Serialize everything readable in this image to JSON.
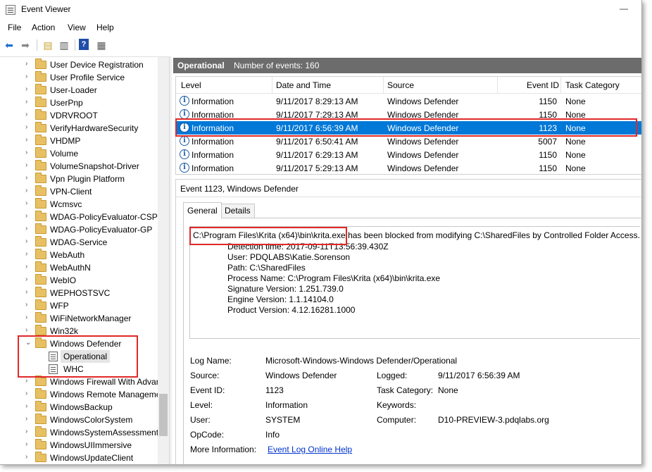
{
  "window": {
    "title": "Event Viewer",
    "minimize": "—"
  },
  "menu": [
    "File",
    "Action",
    "View",
    "Help"
  ],
  "toolbar": {
    "icons": [
      "back-arrow-icon",
      "forward-arrow-icon",
      "up-folder-icon",
      "show-tree-icon",
      "help-icon",
      "properties-icon"
    ]
  },
  "tree": {
    "items": [
      "User Device Registration",
      "User Profile Service",
      "User-Loader",
      "UserPnp",
      "VDRVROOT",
      "VerifyHardwareSecurity",
      "VHDMP",
      "Volume",
      "VolumeSnapshot-Driver",
      "Vpn Plugin Platform",
      "VPN-Client",
      "Wcmsvc",
      "WDAG-PolicyEvaluator-CSP",
      "WDAG-PolicyEvaluator-GP",
      "WDAG-Service",
      "WebAuth",
      "WebAuthN",
      "WebIO",
      "WEPHOSTSVC",
      "WFP",
      "WiFiNetworkManager",
      "Win32k"
    ],
    "expanded": {
      "label": "Windows Defender",
      "children": [
        "Operational",
        "WHC"
      ]
    },
    "items_after": [
      "Windows Firewall With Advanced Security",
      "Windows Remote Management",
      "WindowsBackup",
      "WindowsColorSystem",
      "WindowsSystemAssessmentTool",
      "WindowsUIImmersive",
      "WindowsUpdateClient"
    ]
  },
  "operational": {
    "title": "Operational",
    "count": "Number of events: 160"
  },
  "events": {
    "columns": [
      "Level",
      "Date and Time",
      "Source",
      "Event ID",
      "Task Category"
    ],
    "rows": [
      {
        "level": "Information",
        "date": "9/11/2017 8:29:13 AM",
        "source": "Windows Defender",
        "id": "1150",
        "task": "None"
      },
      {
        "level": "Information",
        "date": "9/11/2017 7:29:13 AM",
        "source": "Windows Defender",
        "id": "1150",
        "task": "None"
      },
      {
        "level": "Information",
        "date": "9/11/2017 6:56:39 AM",
        "source": "Windows Defender",
        "id": "1123",
        "task": "None"
      },
      {
        "level": "Information",
        "date": "9/11/2017 6:50:41 AM",
        "source": "Windows Defender",
        "id": "5007",
        "task": "None"
      },
      {
        "level": "Information",
        "date": "9/11/2017 6:29:13 AM",
        "source": "Windows Defender",
        "id": "1150",
        "task": "None"
      },
      {
        "level": "Information",
        "date": "9/11/2017 5:29:13 AM",
        "source": "Windows Defender",
        "id": "1150",
        "task": "None"
      }
    ],
    "selected_index": 2
  },
  "detail": {
    "title": "Event 1123, Windows Defender",
    "tabs": [
      "General",
      "Details"
    ],
    "description_path": "C:\\Program Files\\Krita (x64)\\bin\\krita.exe",
    "description_rest": " has been blocked from modifying C:\\SharedFiles by Controlled Folder Access.",
    "lines": [
      "Detection time: 2017-09-11T13:56:39.430Z",
      "User: PDQLABS\\Katie.Sorenson",
      "Path: C:\\SharedFiles",
      "Process Name: C:\\Program Files\\Krita (x64)\\bin\\krita.exe",
      "Signature Version: 1.251.739.0",
      "Engine Version: 1.1.14104.0",
      "Product Version: 4.12.16281.1000"
    ],
    "props": {
      "log_name_label": "Log Name:",
      "log_name": "Microsoft-Windows-Windows Defender/Operational",
      "source_label": "Source:",
      "source": "Windows Defender",
      "logged_label": "Logged:",
      "logged": "9/11/2017 6:56:39 AM",
      "event_id_label": "Event ID:",
      "event_id": "1123",
      "task_label": "Task Category:",
      "task": "None",
      "level_label": "Level:",
      "level": "Information",
      "keywords_label": "Keywords:",
      "keywords": "",
      "user_label": "User:",
      "user": "SYSTEM",
      "computer_label": "Computer:",
      "computer": "D10-PREVIEW-3.pdqlabs.org",
      "opcode_label": "OpCode:",
      "opcode": "Info",
      "more_info_label": "More Information:",
      "more_info_link": "Event Log Online Help"
    }
  },
  "colors": {
    "selection": "#0078d7",
    "header_bar": "#6c6c6c",
    "highlight_box": "#e02828",
    "link": "#0033cc"
  }
}
